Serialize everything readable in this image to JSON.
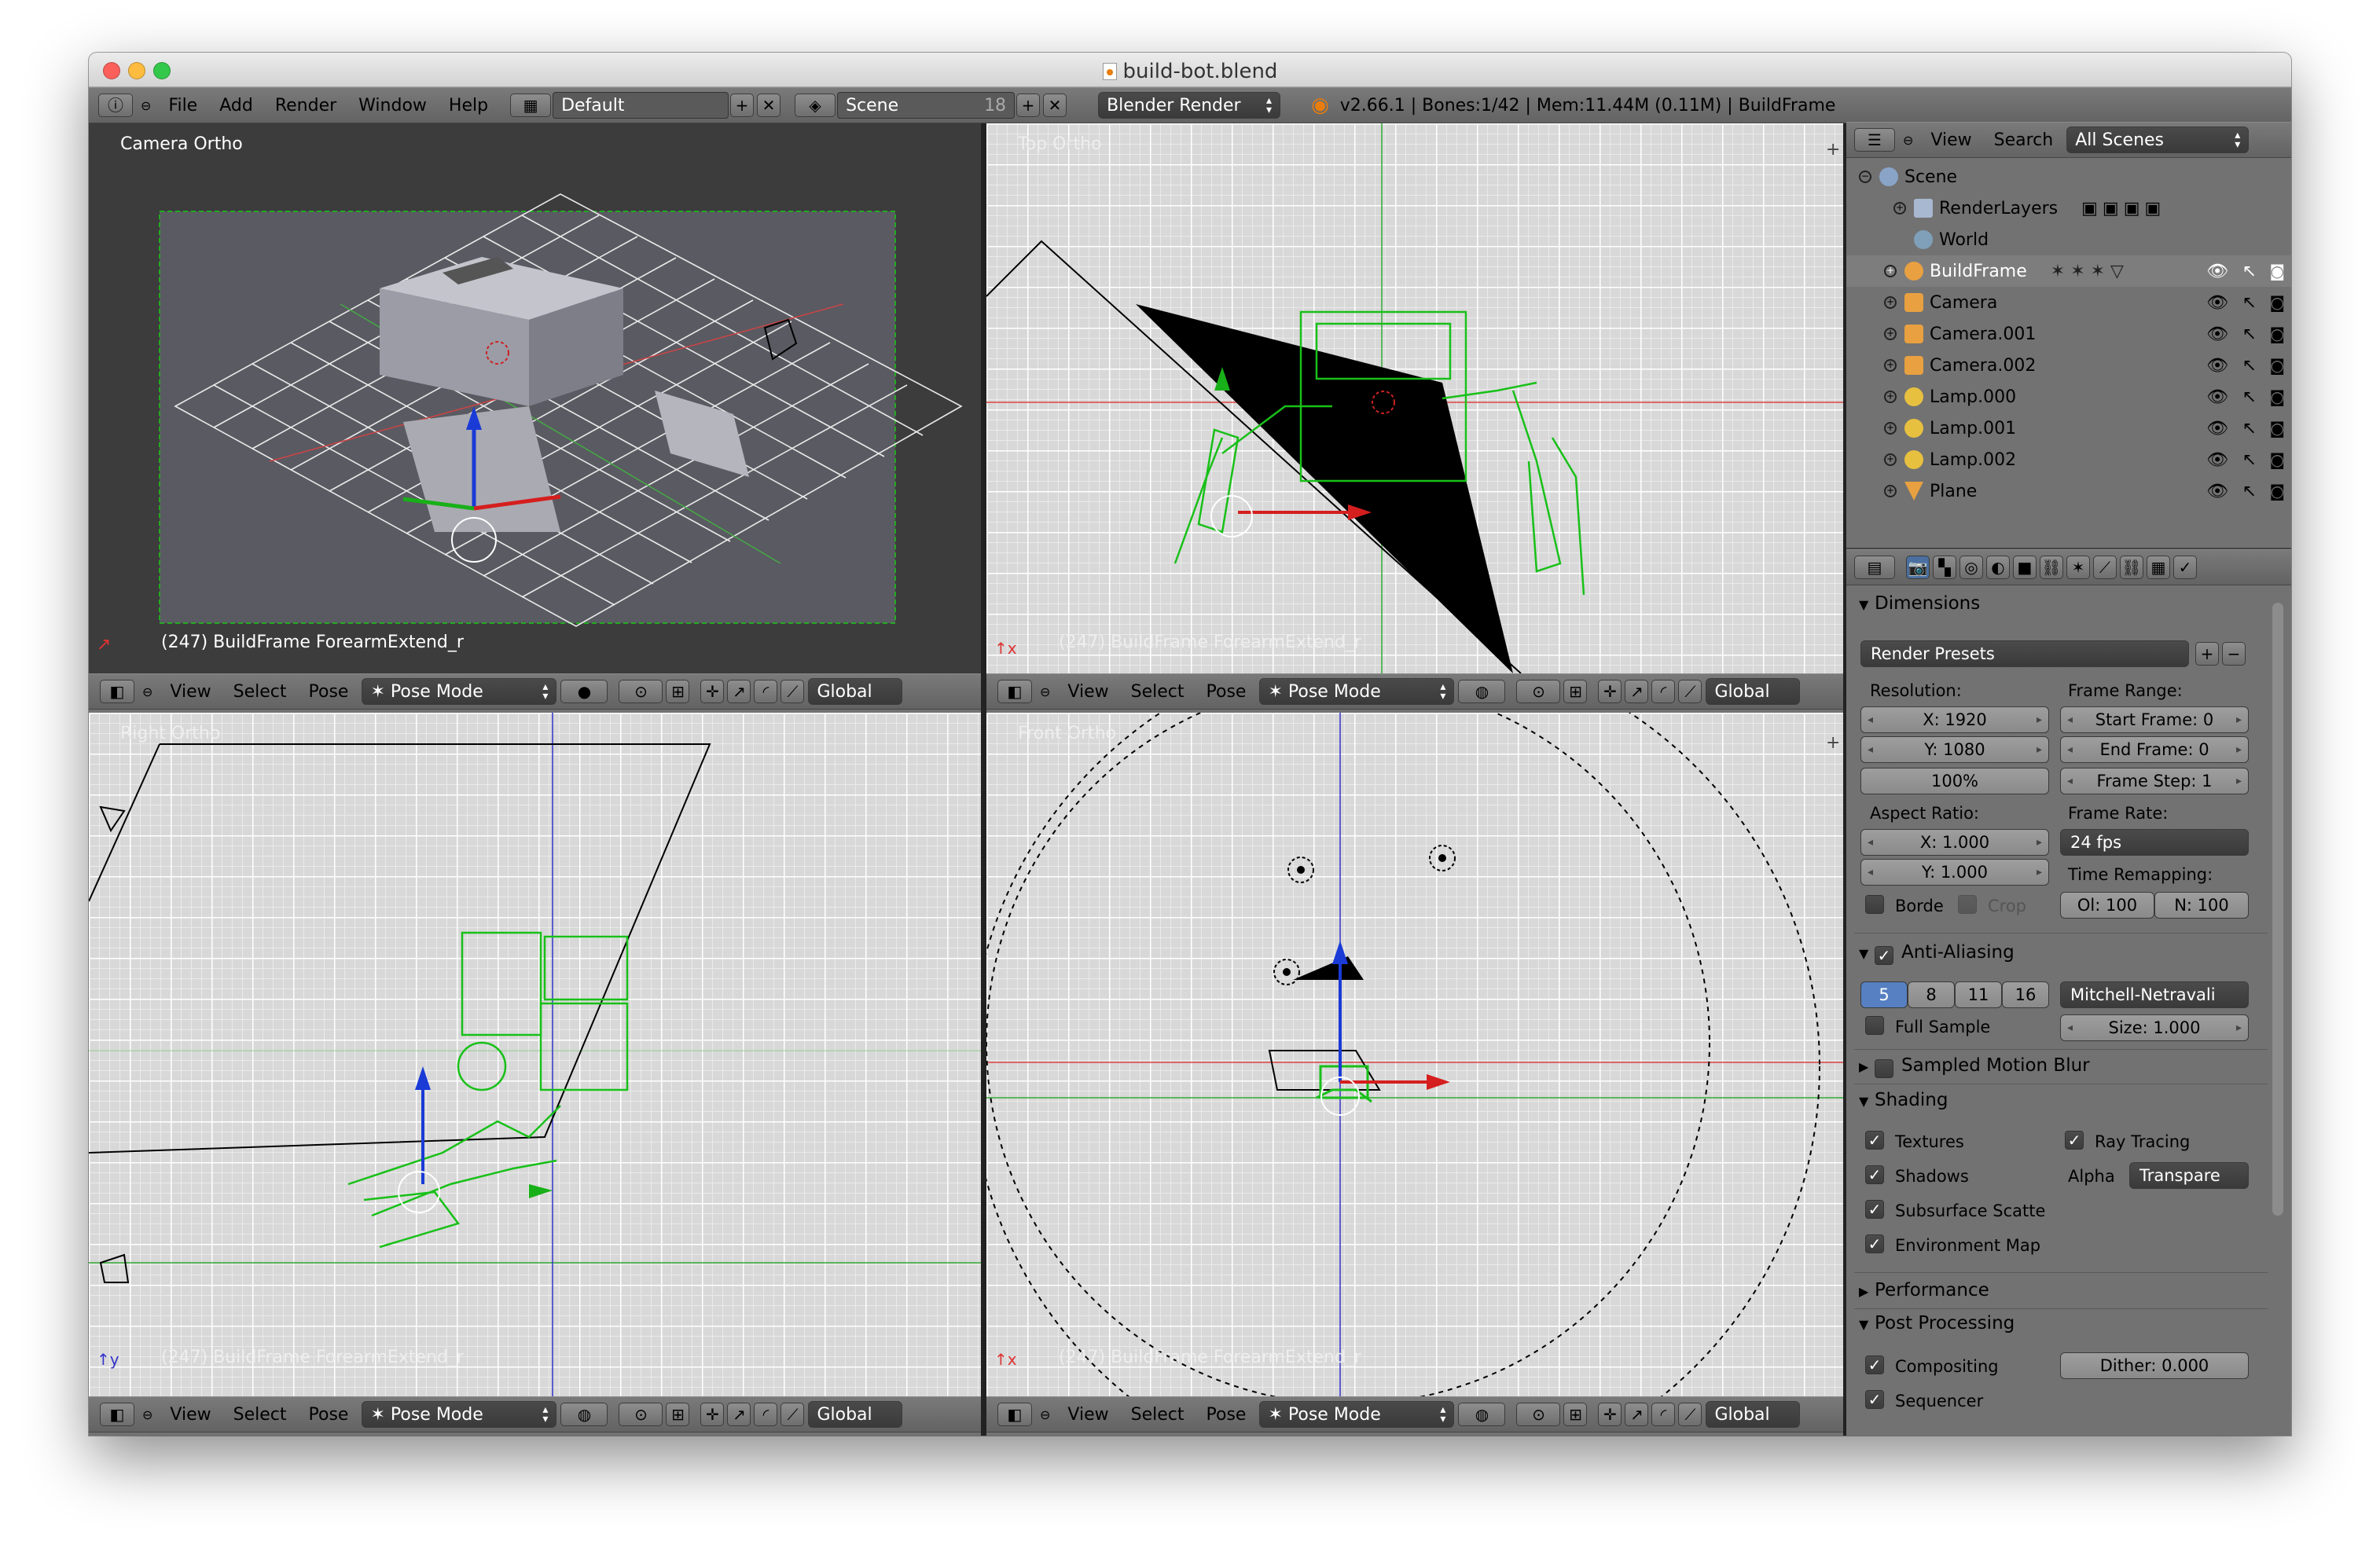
{
  "window": {
    "title": "build-bot.blend"
  },
  "info_header": {
    "menus": [
      "File",
      "Add",
      "Render",
      "Window",
      "Help"
    ],
    "screen_layout": "Default",
    "scene": "Scene",
    "scene_users": "18",
    "render_engine": "Blender Render",
    "stats": "v2.66.1 | Bones:1/42 | Mem:11.44M (0.11M) | BuildFrame"
  },
  "viewports": {
    "camera": {
      "label": "Camera Ortho",
      "status": "(247) BuildFrame ForearmExtend_r"
    },
    "top": {
      "label": "Top Ortho",
      "status": "(247) BuildFrame ForearmExtend_r"
    },
    "right": {
      "label": "Right Ortho",
      "status": "(247) BuildFrame ForearmExtend_r"
    },
    "front": {
      "label": "Front Ortho",
      "status": "(247) BuildFrame ForearmExtend_r"
    }
  },
  "view3d_header": {
    "menus": [
      "View",
      "Select",
      "Pose"
    ],
    "mode": "Pose Mode",
    "orientation": "Global"
  },
  "outliner": {
    "menus": [
      "View",
      "Search"
    ],
    "display": "All Scenes",
    "items": [
      {
        "name": "Scene",
        "icon": "scene-icon"
      },
      {
        "name": "RenderLayers",
        "icon": "renderlayers-icon"
      },
      {
        "name": "World",
        "icon": "world-icon"
      },
      {
        "name": "BuildFrame",
        "icon": "armature-icon"
      },
      {
        "name": "Camera",
        "icon": "camera-object-icon"
      },
      {
        "name": "Camera.001",
        "icon": "camera-object-icon"
      },
      {
        "name": "Camera.002",
        "icon": "camera-object-icon"
      },
      {
        "name": "Lamp.000",
        "icon": "lamp-icon"
      },
      {
        "name": "Lamp.001",
        "icon": "lamp-icon"
      },
      {
        "name": "Lamp.002",
        "icon": "lamp-icon"
      },
      {
        "name": "Plane",
        "icon": "mesh-icon"
      }
    ]
  },
  "properties": {
    "dimensions": {
      "title": "Dimensions",
      "presets": "Render Presets",
      "resolution_label": "Resolution:",
      "res_x": "X: 1920",
      "res_y": "Y: 1080",
      "res_pct": "100%",
      "frame_range_label": "Frame Range:",
      "start": "Start Frame: 0",
      "end": "End Frame: 0",
      "step": "Frame Step: 1",
      "aspect_label": "Aspect Ratio:",
      "aspect_x": "X: 1.000",
      "aspect_y": "Y: 1.000",
      "frame_rate_label": "Frame Rate:",
      "fps": "24 fps",
      "time_remap_label": "Time Remapping:",
      "old": "Ol: 100",
      "new": "N: 100",
      "border": "Borde",
      "crop": "Crop"
    },
    "aa": {
      "title": "Anti-Aliasing",
      "samples": [
        "5",
        "8",
        "11",
        "16"
      ],
      "filter": "Mitchell-Netravali",
      "full_sample": "Full Sample",
      "size": "Size: 1.000"
    },
    "motion_blur": "Sampled Motion Blur",
    "shading": {
      "title": "Shading",
      "textures": "Textures",
      "shadows": "Shadows",
      "sss": "Subsurface Scatte",
      "envmap": "Environment Map",
      "raytracing": "Ray Tracing",
      "alpha_label": "Alpha",
      "alpha": "Transpare"
    },
    "performance": "Performance",
    "post": {
      "title": "Post Processing",
      "compositing": "Compositing",
      "sequencer": "Sequencer",
      "dither": "Dither: 0.000"
    }
  }
}
